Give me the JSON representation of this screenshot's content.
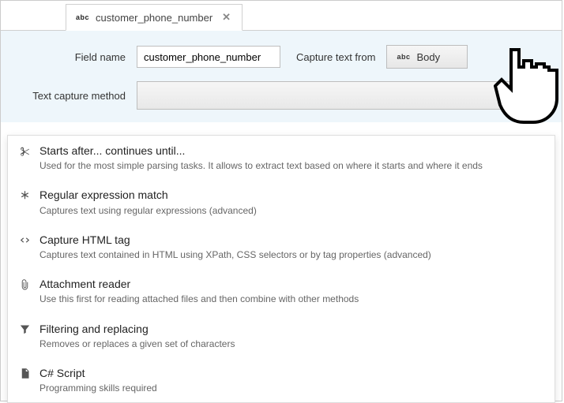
{
  "tab": {
    "icon_label": "abc",
    "title": "customer_phone_number"
  },
  "form": {
    "field_name_label": "Field name",
    "field_name_value": "customer_phone_number",
    "capture_from_label": "Capture text from",
    "capture_from_icon": "abc",
    "capture_from_value": "Body",
    "method_label": "Text capture method"
  },
  "methods": [
    {
      "icon": "scissors",
      "title": "Starts after... continues until...",
      "desc": "Used for the most simple parsing tasks. It allows to extract text based on where it starts and where it ends"
    },
    {
      "icon": "asterisk",
      "title": "Regular expression match",
      "desc": "Captures text using regular expressions (advanced)"
    },
    {
      "icon": "code",
      "title": "Capture HTML tag",
      "desc": "Captures text contained in HTML using XPath, CSS selectors or by tag properties (advanced)"
    },
    {
      "icon": "paperclip",
      "title": "Attachment reader",
      "desc": "Use this first for reading attached files and then combine with other methods"
    },
    {
      "icon": "filter",
      "title": "Filtering and replacing",
      "desc": "Removes or replaces a given set of characters"
    },
    {
      "icon": "script",
      "title": "C# Script",
      "desc": "Programming skills required"
    }
  ]
}
